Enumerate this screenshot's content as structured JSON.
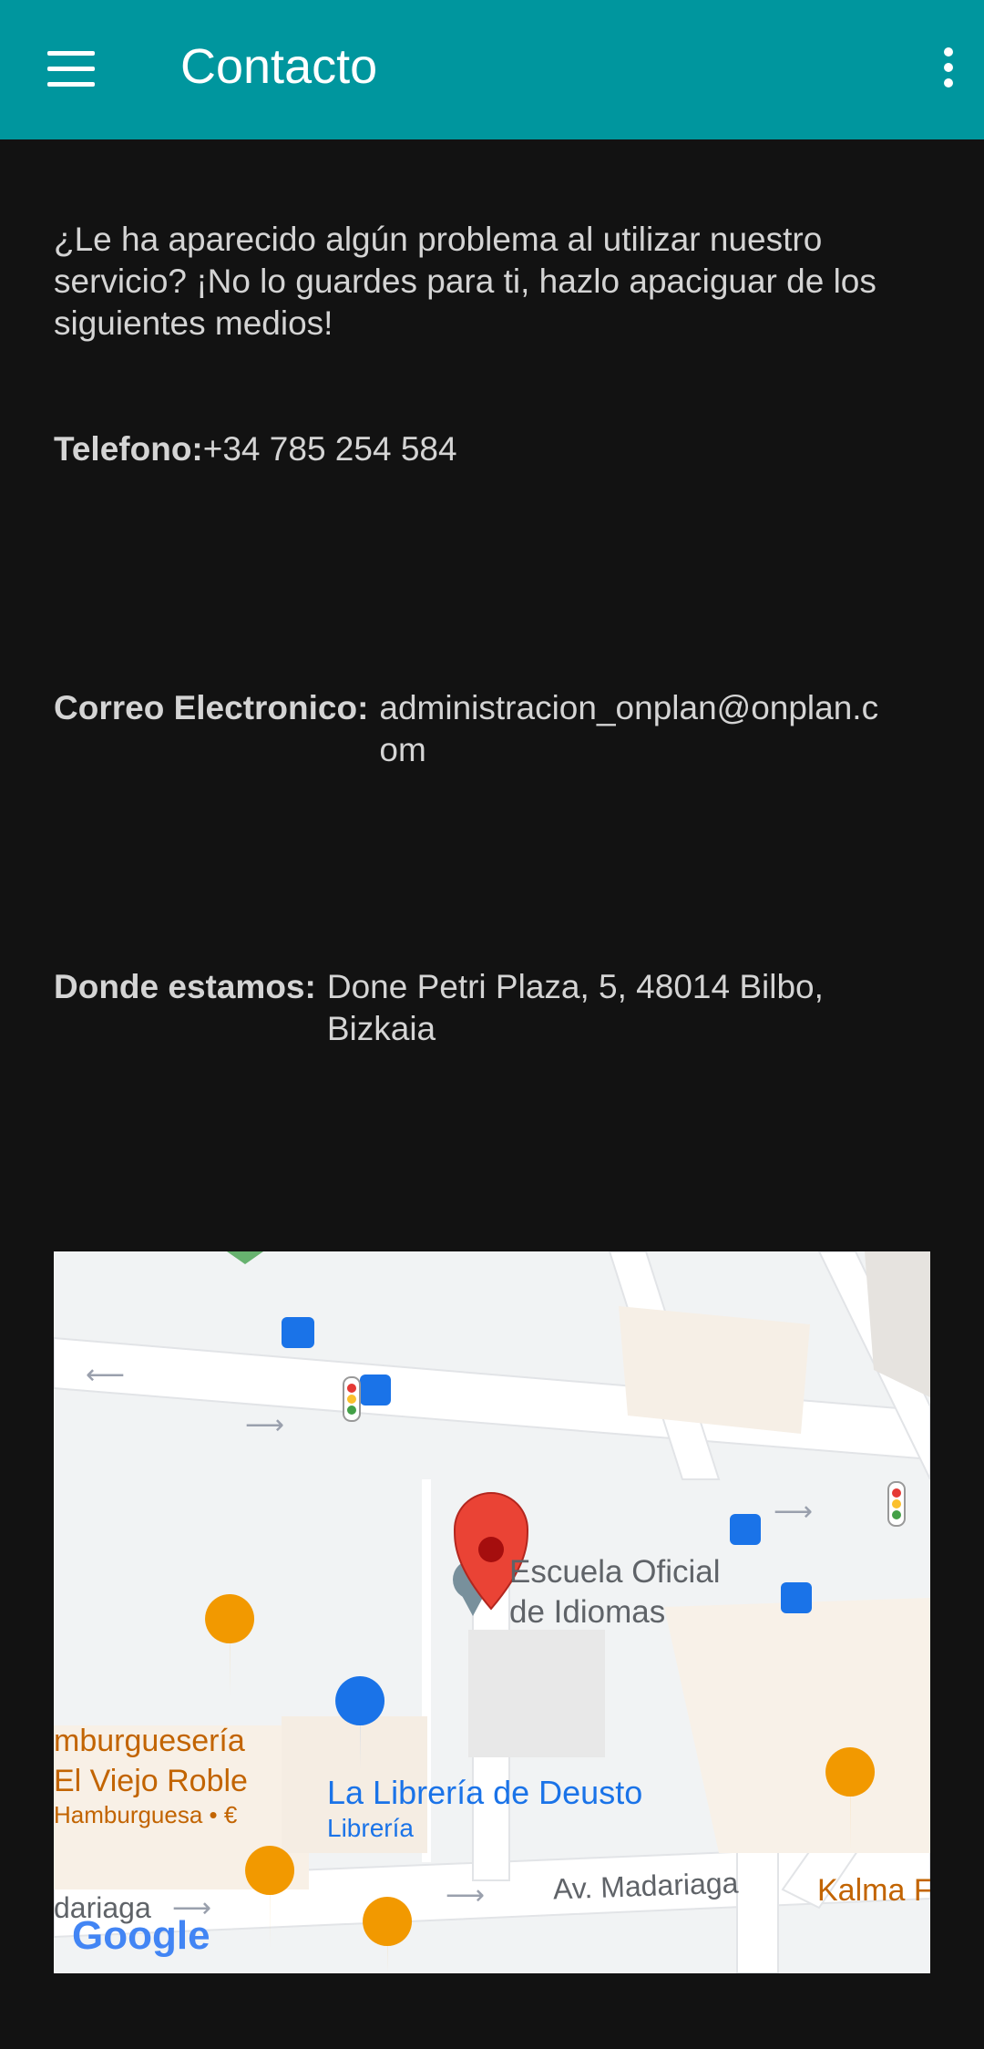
{
  "appbar": {
    "title": "Contacto"
  },
  "intro": "¿Le ha aparecido algún problema al utilizar nuestro servicio? ¡No lo guardes para ti, hazlo apaciguar de los siguientes medios!",
  "contact": {
    "phone_label": "Telefono:",
    "phone_value": "+34 785 254 584",
    "email_label": "Correo Electronico:",
    "email_value": "administracion_onplan@onplan.com",
    "address_label": "Donde estamos:",
    "address_value": "Done Petri Plaza, 5, 48014 Bilbo, Bizkaia"
  },
  "map": {
    "poi_school_line1": "Escuela Oficial",
    "poi_school_line2": "de Idiomas",
    "poi_burger_line1": "mburguesería",
    "poi_burger_line2": "El Viejo Roble",
    "poi_burger_sub": "Hamburguesa • €",
    "poi_bookstore": "La Librería de Deusto",
    "poi_bookstore_sub": "Librería",
    "street_main": "Av. Madariaga",
    "street_left": "dariaga",
    "poi_kalma": "Kalma F",
    "google_logo": "Google",
    "colors": {
      "pin": "#ea4335",
      "poi_orange": "#f29900",
      "poi_blue": "#1a73e8"
    }
  }
}
